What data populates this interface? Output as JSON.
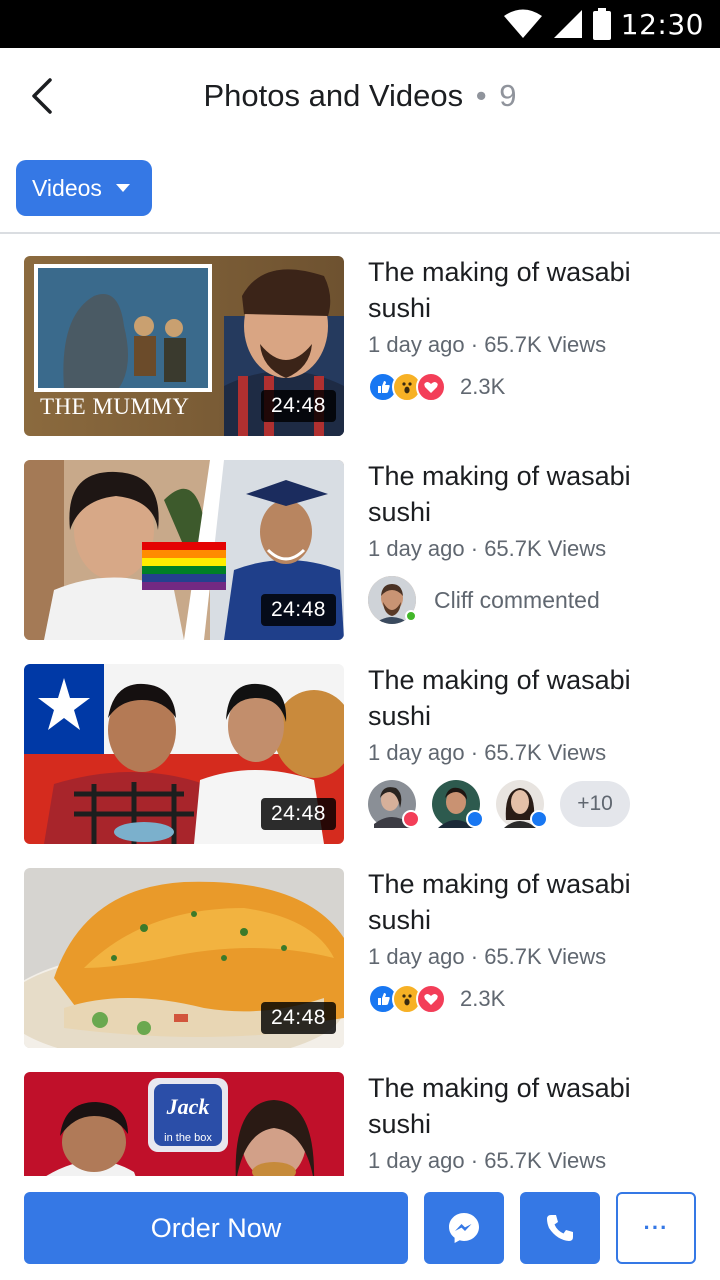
{
  "status_bar": {
    "time": "12:30"
  },
  "header": {
    "title": "Photos and Videos",
    "separator": "•",
    "count": "9"
  },
  "filter": {
    "label": "Videos"
  },
  "videos": [
    {
      "title": "The making of wasabi sushi",
      "meta": "1 day ago · 65.7K Views",
      "duration": "24:48",
      "thumb_caption": "THE MUMMY",
      "reactions_count": "2.3K"
    },
    {
      "title": "The making of wasabi sushi",
      "meta": "1 day ago · 65.7K Views",
      "duration": "24:48",
      "comment": "Cliff commented"
    },
    {
      "title": "The making of wasabi sushi",
      "meta": "1 day ago · 65.7K Views",
      "duration": "24:48",
      "more_friends": "+10"
    },
    {
      "title": "The making of wasabi sushi",
      "meta": "1 day ago · 65.7K Views",
      "duration": "24:48",
      "reactions_count": "2.3K"
    },
    {
      "title": "The making of wasabi sushi",
      "meta": "1 day ago · 65.7K Views",
      "thumb_logo_top": "Jack",
      "thumb_logo_bottom": "in the box"
    }
  ],
  "bottom_bar": {
    "order_label": "Order Now",
    "more_label": "···"
  },
  "colors": {
    "accent": "#3578e5",
    "like": "#1877f2",
    "love": "#f33e58",
    "wow": "#f7b125",
    "text_secondary": "#606770"
  },
  "icons": [
    "back-arrow-icon",
    "wifi-icon",
    "signal-icon",
    "battery-icon",
    "caret-down-icon",
    "like-reaction-icon",
    "wow-reaction-icon",
    "love-reaction-icon",
    "messenger-icon",
    "phone-icon",
    "more-dots-icon"
  ]
}
